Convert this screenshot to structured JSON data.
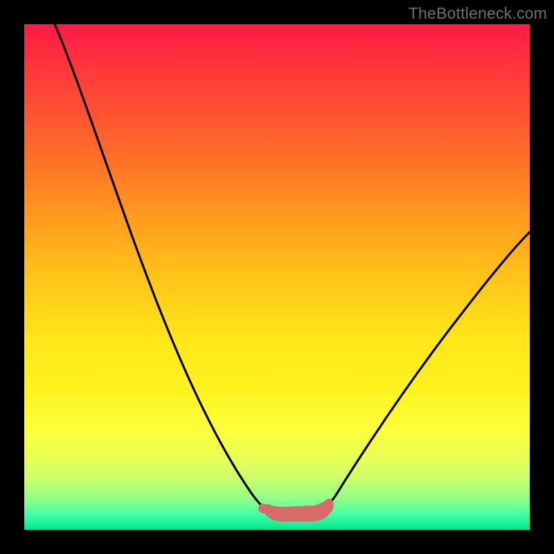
{
  "watermark": "TheBottleneck.com",
  "colors": {
    "frame": "#000000",
    "gradient_top": "#ff1a44",
    "gradient_bottom": "#00e88f",
    "curve": "#000000",
    "marker": "#d96a6a"
  },
  "chart_data": {
    "type": "line",
    "title": "",
    "xlabel": "",
    "ylabel": "",
    "xlim": [
      0,
      100
    ],
    "ylim": [
      0,
      100
    ],
    "series": [
      {
        "name": "bottleneck-curve",
        "x": [
          6,
          10,
          15,
          20,
          25,
          30,
          35,
          40,
          45,
          49,
          51,
          55,
          58,
          60,
          63,
          70,
          80,
          90,
          100
        ],
        "y": [
          100,
          90,
          78,
          66,
          54,
          42,
          31,
          21,
          11,
          4,
          3,
          3,
          3,
          4,
          8,
          18,
          32,
          45,
          58
        ]
      }
    ],
    "markers": {
      "name": "flat-bottom-highlight",
      "color": "#d96a6a",
      "points_x": [
        49,
        50,
        51,
        52,
        53,
        54,
        55,
        56,
        57,
        58,
        59
      ],
      "points_y": [
        4,
        3.2,
        3,
        3,
        3,
        3,
        3,
        3,
        3,
        3,
        3.5
      ]
    }
  }
}
